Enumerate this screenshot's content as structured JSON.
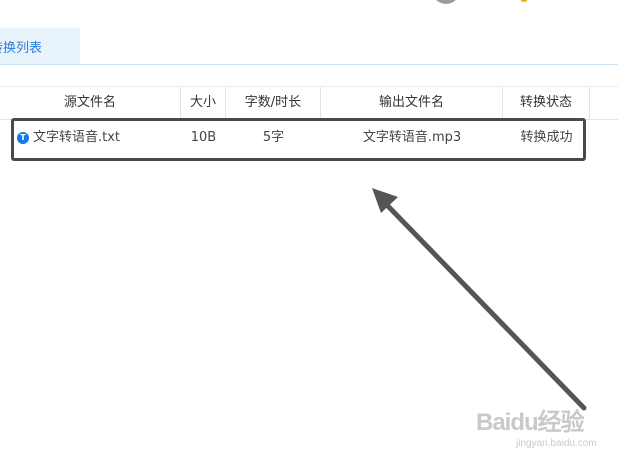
{
  "tabs": {
    "active_label": "转换列表"
  },
  "table": {
    "columns": [
      "源文件名",
      "大小",
      "字数/时长",
      "输出文件名",
      "转换状态"
    ],
    "rows": [
      {
        "icon": "text-file-icon",
        "icon_glyph": "T",
        "source_name": "文字转语音.txt",
        "size": "10B",
        "count": "5字",
        "output_name": "文字转语音.mp3",
        "status": "转换成功"
      }
    ]
  },
  "annotation": {
    "box_color": "#4a4a4a",
    "arrow_color": "#555555"
  },
  "watermark": {
    "main": "Baidu经验",
    "sub": "jingyan.baidu.com"
  },
  "colors": {
    "accent": "#2a7fd4",
    "tab_bg": "#e8f3fc",
    "icon_blue": "#1677e6"
  }
}
